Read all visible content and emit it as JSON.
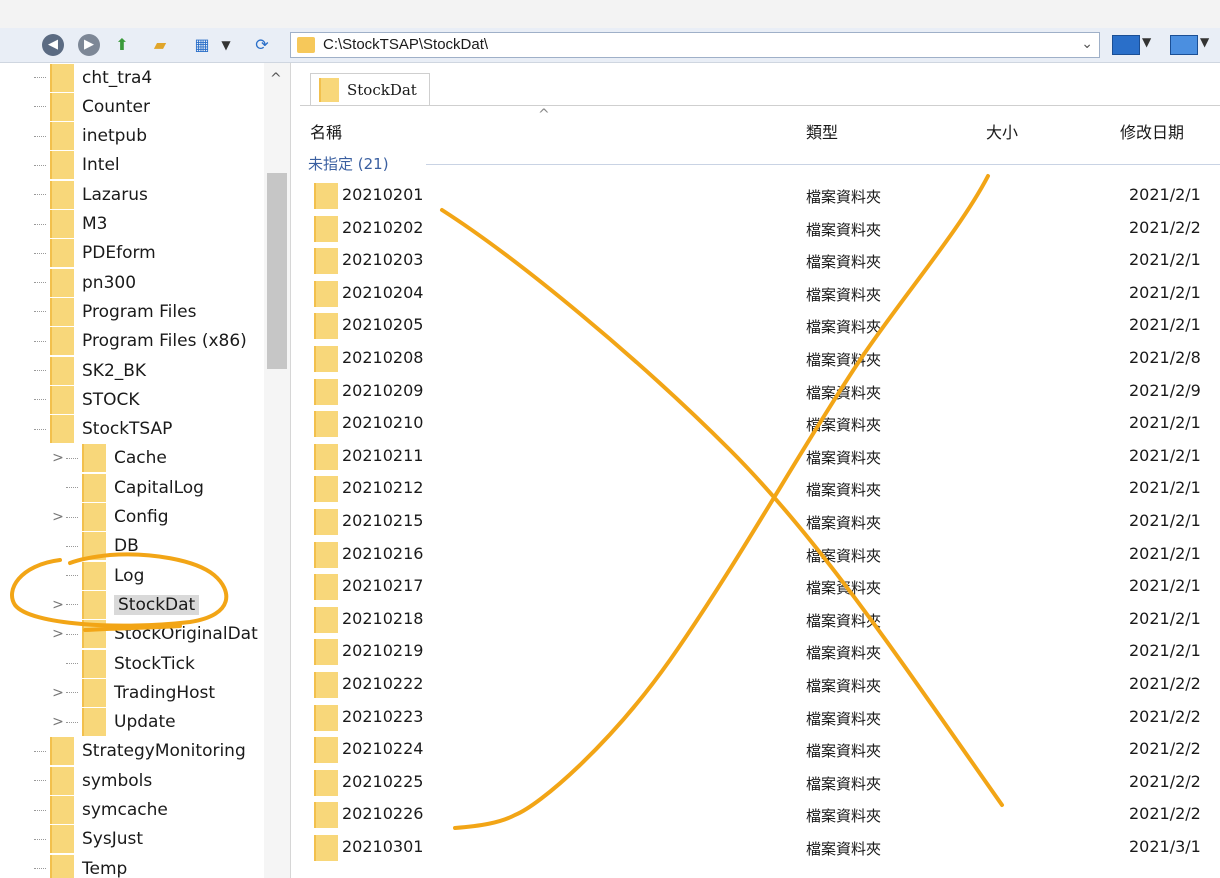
{
  "address": {
    "path": "C:\\StockTSAP\\StockDat\\",
    "dropdown_icon": "chevron-down-icon"
  },
  "toolbar": {
    "icons": [
      "back-icon",
      "forward-icon",
      "up-folder-icon",
      "new-folder-icon",
      "view-icon",
      "refresh-icon"
    ]
  },
  "tree": {
    "items": [
      {
        "label": "cht_tra4",
        "level": 0
      },
      {
        "label": "Counter",
        "level": 0
      },
      {
        "label": "inetpub",
        "level": 0
      },
      {
        "label": "Intel",
        "level": 0
      },
      {
        "label": "Lazarus",
        "level": 0
      },
      {
        "label": "M3",
        "level": 0
      },
      {
        "label": "PDEform",
        "level": 0
      },
      {
        "label": "pn300",
        "level": 0
      },
      {
        "label": "Program Files",
        "level": 0
      },
      {
        "label": "Program Files (x86)",
        "level": 0
      },
      {
        "label": "SK2_BK",
        "level": 0
      },
      {
        "label": "STOCK",
        "level": 0
      },
      {
        "label": "StockTSAP",
        "level": 0
      },
      {
        "label": "Cache",
        "level": 1,
        "expandable": true
      },
      {
        "label": "CapitalLog",
        "level": 1
      },
      {
        "label": "Config",
        "level": 1,
        "expandable": true
      },
      {
        "label": "DB",
        "level": 1
      },
      {
        "label": "Log",
        "level": 1
      },
      {
        "label": "StockDat",
        "level": 1,
        "expandable": true,
        "selected": true
      },
      {
        "label": "StockOriginalDat",
        "level": 1,
        "expandable": true
      },
      {
        "label": "StockTick",
        "level": 1
      },
      {
        "label": "TradingHost",
        "level": 1,
        "expandable": true
      },
      {
        "label": "Update",
        "level": 1,
        "expandable": true
      },
      {
        "label": "StrategyMonitoring",
        "level": 0
      },
      {
        "label": "symbols",
        "level": 0
      },
      {
        "label": "symcache",
        "level": 0
      },
      {
        "label": "SysJust",
        "level": 0
      },
      {
        "label": "Temp",
        "level": 0
      }
    ]
  },
  "content": {
    "tab_label": "StockDat",
    "columns": {
      "name": "名稱",
      "type": "類型",
      "size": "大小",
      "date": "修改日期"
    },
    "group_label": "未指定 (21)",
    "rows": [
      {
        "name": "20210201",
        "type": "檔案資料夾",
        "date": "2021/2/1"
      },
      {
        "name": "20210202",
        "type": "檔案資料夾",
        "date": "2021/2/2"
      },
      {
        "name": "20210203",
        "type": "檔案資料夾",
        "date": "2021/2/1"
      },
      {
        "name": "20210204",
        "type": "檔案資料夾",
        "date": "2021/2/1"
      },
      {
        "name": "20210205",
        "type": "檔案資料夾",
        "date": "2021/2/1"
      },
      {
        "name": "20210208",
        "type": "檔案資料夾",
        "date": "2021/2/8"
      },
      {
        "name": "20210209",
        "type": "檔案資料夾",
        "date": "2021/2/9"
      },
      {
        "name": "20210210",
        "type": "檔案資料夾",
        "date": "2021/2/1"
      },
      {
        "name": "20210211",
        "type": "檔案資料夾",
        "date": "2021/2/1"
      },
      {
        "name": "20210212",
        "type": "檔案資料夾",
        "date": "2021/2/1"
      },
      {
        "name": "20210215",
        "type": "檔案資料夾",
        "date": "2021/2/1"
      },
      {
        "name": "20210216",
        "type": "檔案資料夾",
        "date": "2021/2/1"
      },
      {
        "name": "20210217",
        "type": "檔案資料夾",
        "date": "2021/2/1"
      },
      {
        "name": "20210218",
        "type": "檔案資料夾",
        "date": "2021/2/1"
      },
      {
        "name": "20210219",
        "type": "檔案資料夾",
        "date": "2021/2/1"
      },
      {
        "name": "20210222",
        "type": "檔案資料夾",
        "date": "2021/2/2"
      },
      {
        "name": "20210223",
        "type": "檔案資料夾",
        "date": "2021/2/2"
      },
      {
        "name": "20210224",
        "type": "檔案資料夾",
        "date": "2021/2/2"
      },
      {
        "name": "20210225",
        "type": "檔案資料夾",
        "date": "2021/2/2"
      },
      {
        "name": "20210226",
        "type": "檔案資料夾",
        "date": "2021/2/2"
      },
      {
        "name": "20210301",
        "type": "檔案資料夾",
        "date": "2021/3/1"
      }
    ]
  },
  "annotation": {
    "color": "#f2a516",
    "marks": [
      "circle-around-log-and-stockdat",
      "cross-over-file-list"
    ]
  }
}
